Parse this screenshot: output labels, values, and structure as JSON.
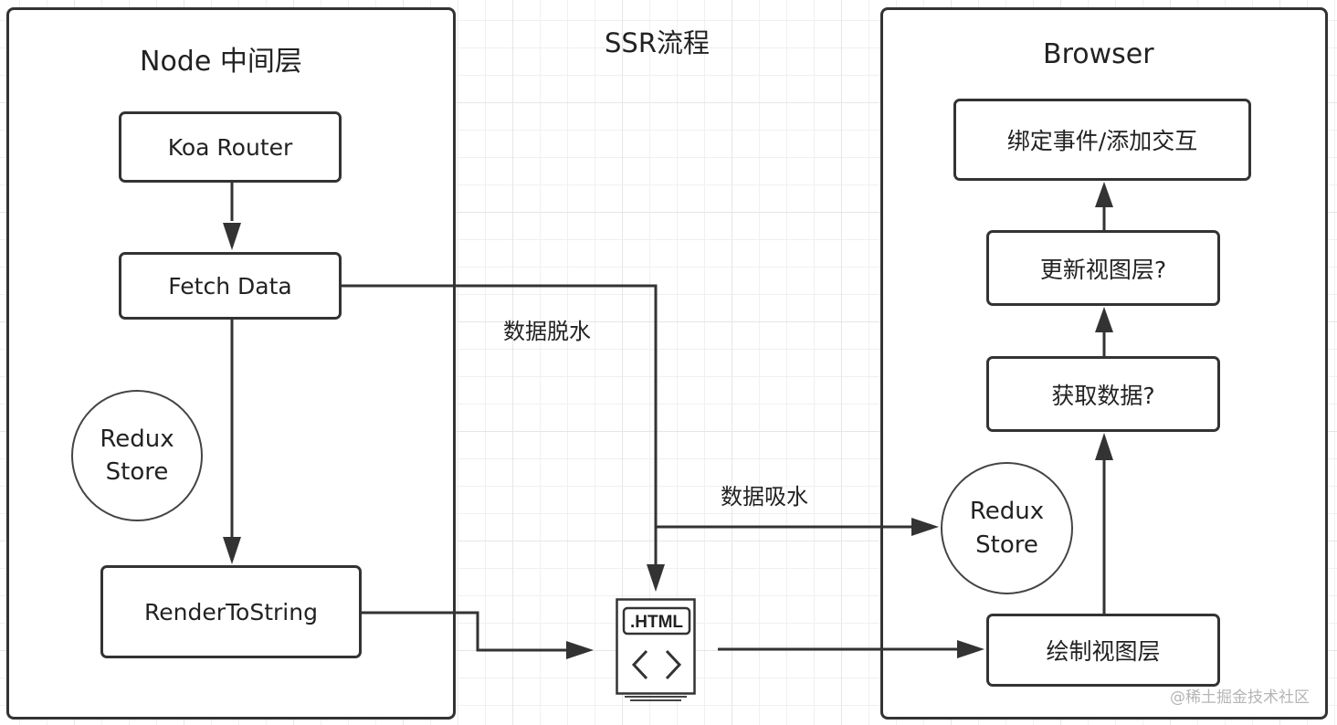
{
  "diagram_title": "SSR流程",
  "node_layer": {
    "title": "Node 中间层",
    "nodes": {
      "koa_router": "Koa Router",
      "fetch_data": "Fetch Data",
      "render_to_string": "RenderToString"
    },
    "redux_store": {
      "line1": "Redux",
      "line2": "Store"
    }
  },
  "browser_layer": {
    "title": "Browser",
    "nodes": {
      "bind_events": "绑定事件/添加交互",
      "update_view": "更新视图层?",
      "fetch_data": "获取数据?",
      "draw_view": "绘制视图层"
    },
    "redux_store": {
      "line1": "Redux",
      "line2": "Store"
    }
  },
  "html_file": {
    "label": ".HTML",
    "glyph": "< >"
  },
  "edge_labels": {
    "dehydrate": "数据脱水",
    "hydrate": "数据吸水"
  },
  "watermark": "@稀土掘金技术社区",
  "colors": {
    "stroke": "#333333",
    "grid_major": "#e6e6e6",
    "grid_minor": "#f0f0f0",
    "watermark": "#b5b5b5"
  }
}
